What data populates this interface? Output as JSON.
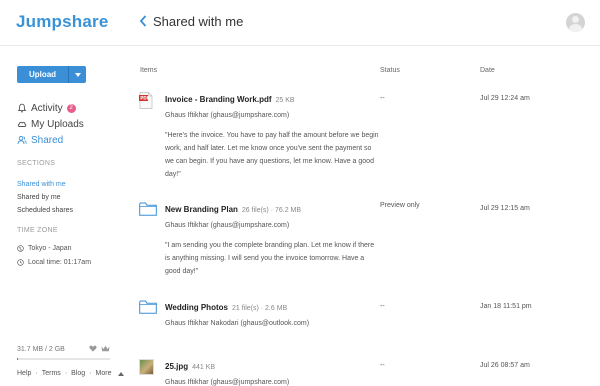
{
  "app": {
    "name": "Jumpshare"
  },
  "header": {
    "title": "Shared with me"
  },
  "colors": {
    "accent": "#3a8fd6",
    "badge": "#e85d8c",
    "pdf": "#d9322b"
  },
  "sidebar": {
    "upload_label": "Upload",
    "nav": [
      {
        "label": "Activity",
        "icon": "bell-icon",
        "badge": "2"
      },
      {
        "label": "My Uploads",
        "icon": "cloud-icon"
      },
      {
        "label": "Shared",
        "icon": "users-icon",
        "active": true
      }
    ],
    "sections_heading": "SECTIONS",
    "sections": [
      {
        "label": "Shared with me",
        "active": true
      },
      {
        "label": "Shared by me"
      },
      {
        "label": "Scheduled shares"
      }
    ],
    "timezone_heading": "TIME ZONE",
    "timezone": "Tokyo - Japan",
    "local_time": "Local time: 01:17am",
    "storage": "31.7 MB / 2 GB",
    "storage_fraction": 0.015,
    "footer_links": [
      "Help",
      "Terms",
      "Blog",
      "More"
    ]
  },
  "list": {
    "columns": {
      "items": "Items",
      "status": "Status",
      "date": "Date"
    },
    "rows": [
      {
        "icon": "pdf-file-icon",
        "name": "Invoice - Branding Work.pdf",
        "meta": "25 KB",
        "owner": "Ghaus Iftikhar (ghaus@jumpshare.com)",
        "message": "\"Here's the invoice. You have to pay half the amount before we begin work, and half later. Let me know once you've sent the payment so we can begin. If you have any questions, let me know. Have a good day!\"",
        "status": "--",
        "date": "Jul 29 12:24 am"
      },
      {
        "icon": "folder-icon",
        "name": "New Branding Plan",
        "meta": "26 file(s) · 76.2 MB",
        "owner": "Ghaus Iftikhar (ghaus@jumpshare.com)",
        "message": "\"I am sending you the complete branding plan. Let me know if there is anything missing. I will send you the invoice tomorrow. Have a good day!\"",
        "status": "Preview only",
        "date": "Jul 29 12:15 am"
      },
      {
        "icon": "folder-icon",
        "name": "Wedding Photos",
        "meta": "21 file(s) · 2.6 MB",
        "owner": "Ghaus Iftikhar Nakodari (ghaus@outlook.com)",
        "message": "",
        "status": "--",
        "date": "Jan 18 11:51 pm"
      },
      {
        "icon": "image-thumbnail",
        "name": "25.jpg",
        "meta": "441 KB",
        "owner": "Ghaus Iftikhar (ghaus@jumpshare.com)",
        "message": "",
        "status": "--",
        "date": "Jul 26 08:57 am"
      }
    ]
  }
}
